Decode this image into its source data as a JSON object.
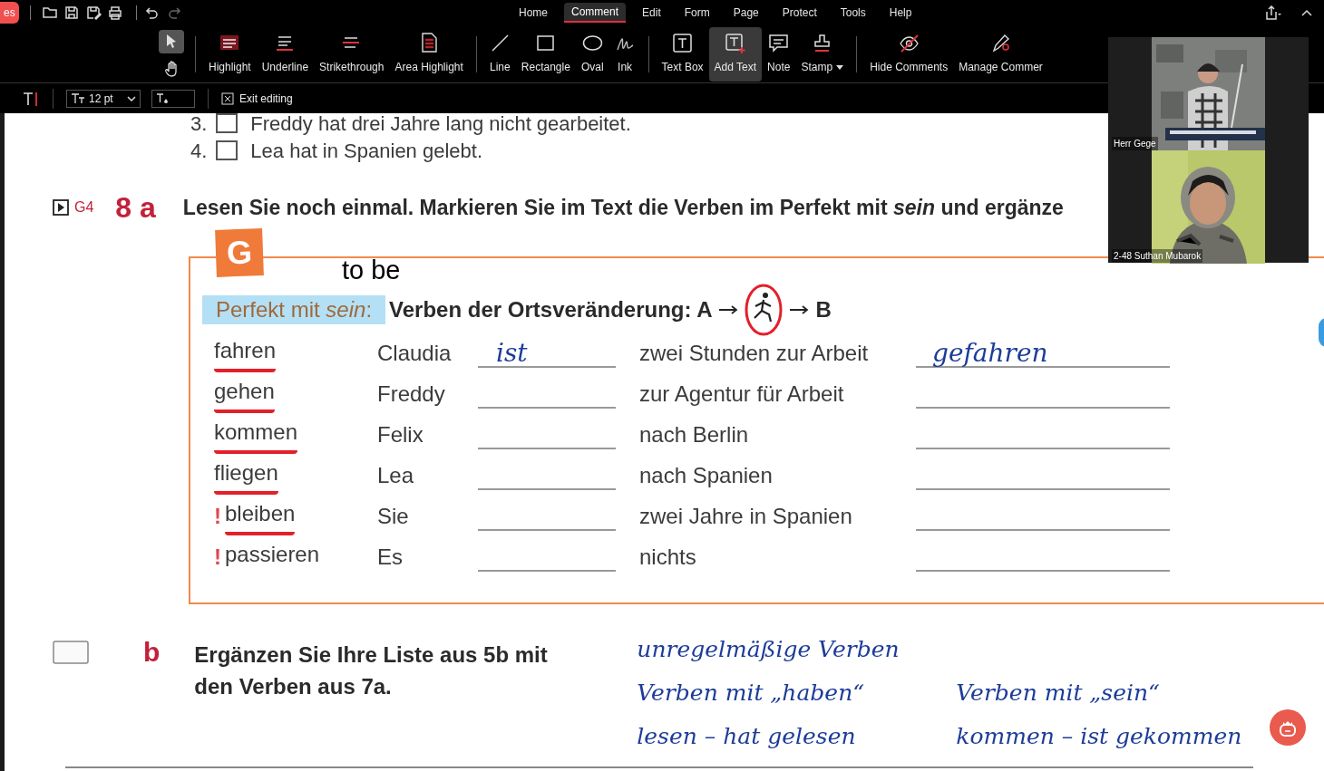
{
  "titlebar": {
    "file_tab": "es",
    "menu": [
      {
        "label": "Home",
        "selected": false
      },
      {
        "label": "Comment",
        "selected": true
      },
      {
        "label": "Edit",
        "selected": false
      },
      {
        "label": "Form",
        "selected": false
      },
      {
        "label": "Page",
        "selected": false
      },
      {
        "label": "Protect",
        "selected": false
      },
      {
        "label": "Tools",
        "selected": false
      },
      {
        "label": "Help",
        "selected": false
      }
    ]
  },
  "ribbon": {
    "pointer_tools": [
      {
        "kind": "select",
        "selected": true
      },
      {
        "kind": "hand",
        "selected": false
      }
    ],
    "groups": [
      [
        {
          "kind": "highlight",
          "label": "Highlight",
          "selected": false,
          "has_menu": false
        },
        {
          "kind": "underline",
          "label": "Underline",
          "selected": false,
          "has_menu": false
        },
        {
          "kind": "strikethrough",
          "label": "Strikethrough",
          "selected": false,
          "has_menu": false
        },
        {
          "kind": "area",
          "label": "Area Highlight",
          "selected": false,
          "has_menu": false
        }
      ],
      [
        {
          "kind": "line",
          "label": "Line",
          "selected": false,
          "has_menu": false
        },
        {
          "kind": "rectangle",
          "label": "Rectangle",
          "selected": false,
          "has_menu": false
        },
        {
          "kind": "oval",
          "label": "Oval",
          "selected": false,
          "has_menu": false
        },
        {
          "kind": "ink",
          "label": "Ink",
          "selected": false,
          "has_menu": false
        }
      ],
      [
        {
          "kind": "textbox",
          "label": "Text Box",
          "selected": false,
          "has_menu": false
        },
        {
          "kind": "addtext",
          "label": "Add Text",
          "selected": true,
          "has_menu": false
        },
        {
          "kind": "note",
          "label": "Note",
          "selected": false,
          "has_menu": false
        },
        {
          "kind": "stamp",
          "label": "Stamp",
          "selected": false,
          "has_menu": true
        }
      ],
      [
        {
          "kind": "hide",
          "label": "Hide Comments",
          "selected": false,
          "has_menu": false
        },
        {
          "kind": "manage",
          "label": "Manage Commer",
          "selected": false,
          "has_menu": false
        }
      ]
    ]
  },
  "edit_bar": {
    "font_size": "12 pt",
    "exit_label": "Exit editing"
  },
  "document": {
    "statements": [
      {
        "number": "3.",
        "text": "Freddy hat drei Jahre lang nicht gearbeitet.",
        "checked": false
      },
      {
        "number": "4.",
        "text": "Lea hat in Spanien gelebt.",
        "checked": false
      }
    ],
    "exercise_a": {
      "grammar_ref": "G4",
      "number": "8 a",
      "instruction": "Lesen Sie noch einmal. Markieren Sie im Text die Verben im Perfekt mit *sein* und ergänze",
      "badge": "G",
      "typed_note": "to be",
      "rule_label": "Perfekt mit *sein*:",
      "rule_text": "Verben der Ortsveränderung: A",
      "rule_end": "B",
      "rows": [
        {
          "verb": "fahren",
          "underlined": true,
          "subject": "Claudia",
          "aux": "ist",
          "phrase": "zwei Stunden zur Arbeit",
          "participle": "gefahren"
        },
        {
          "verb": "gehen",
          "underlined": true,
          "subject": "Freddy",
          "phrase": "zur Agentur für Arbeit"
        },
        {
          "verb": "kommen",
          "underlined": true,
          "subject": "Felix",
          "phrase": "nach Berlin"
        },
        {
          "verb": "fliegen",
          "underlined": true,
          "subject": "Lea",
          "phrase": "nach Spanien"
        },
        {
          "note": "!",
          "verb": "bleiben",
          "underlined": true,
          "subject": "Sie",
          "phrase": "zwei Jahre in Spanien"
        },
        {
          "note": "!",
          "verb": "passieren",
          "underlined": false,
          "subject": "Es",
          "phrase": "nichts"
        }
      ]
    },
    "exercise_b": {
      "letter": "b",
      "instruction": "Ergänzen Sie Ihre Liste aus 5b mit den Verben aus 7a.",
      "handwriting": [
        [
          "unregelmäßige Verben"
        ],
        [
          "Verben mit „haben“",
          "Verben mit „sein“"
        ],
        [
          "lesen – hat gelesen",
          "kommen – ist gekommen"
        ]
      ]
    }
  },
  "video_panel": {
    "participants": [
      {
        "name": "Herr Gege",
        "kind": "picture"
      },
      {
        "name": "2-48 Suthan Mubarok",
        "kind": "picture"
      }
    ]
  }
}
